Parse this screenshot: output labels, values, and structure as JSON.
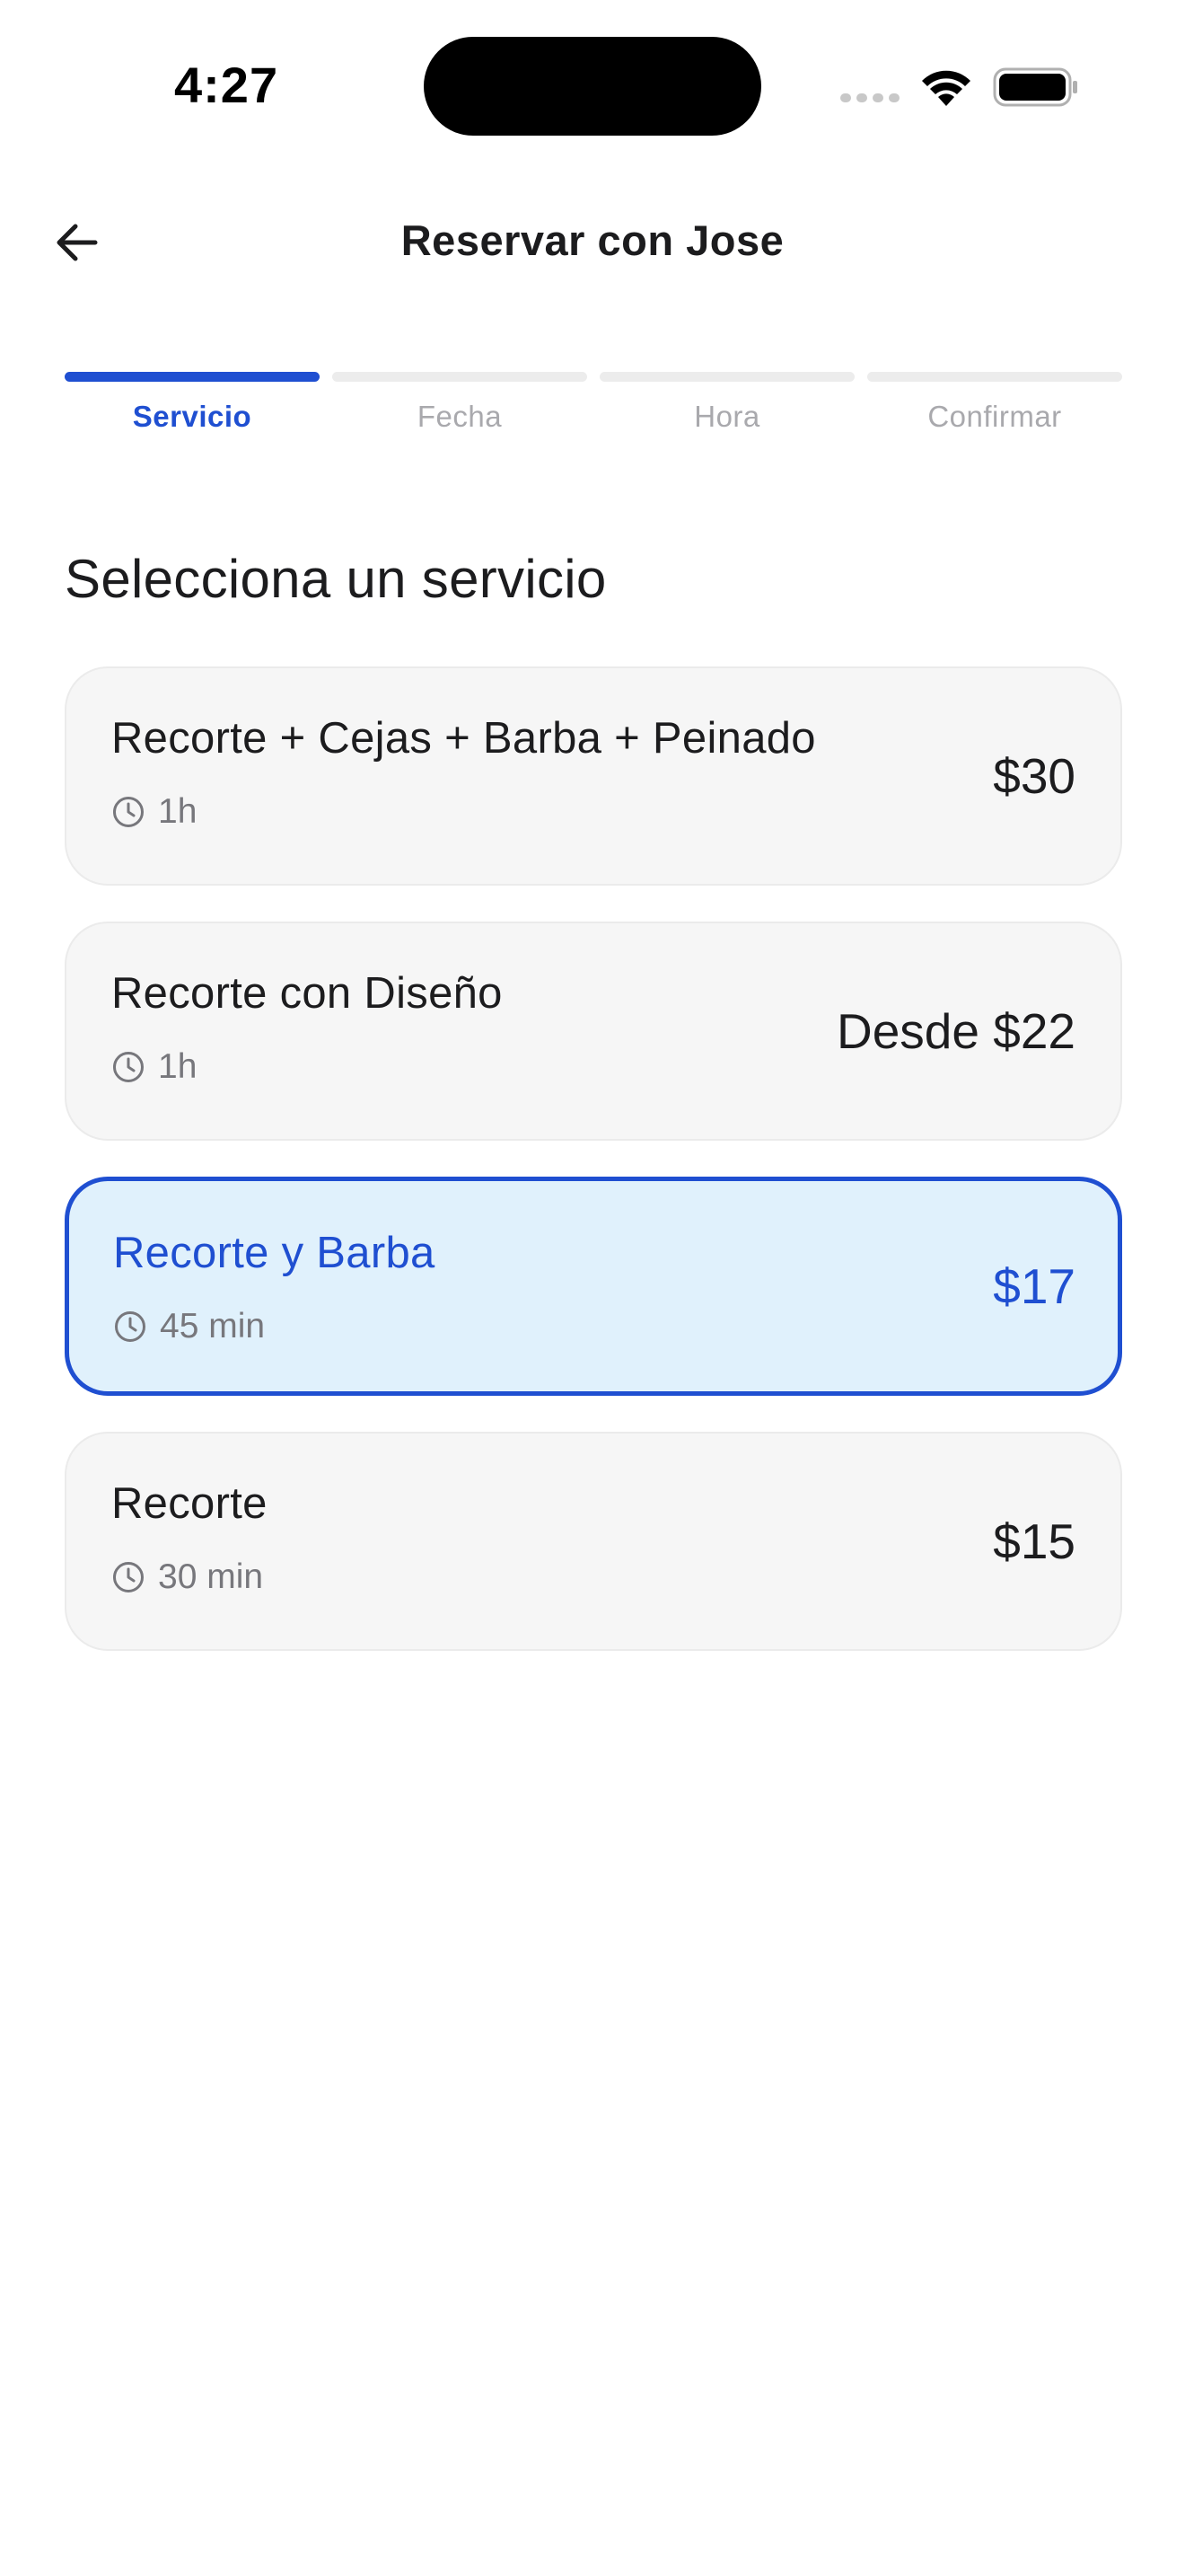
{
  "status_bar": {
    "time": "4:27"
  },
  "header": {
    "title": "Reservar con Jose",
    "back_icon": "arrow-left-icon"
  },
  "steps": [
    {
      "label": "Servicio",
      "active": true
    },
    {
      "label": "Fecha",
      "active": false
    },
    {
      "label": "Hora",
      "active": false
    },
    {
      "label": "Confirmar",
      "active": false
    }
  ],
  "section": {
    "title": "Selecciona un servicio"
  },
  "services": [
    {
      "name": "Recorte + Cejas + Barba + Peinado",
      "duration": "1h",
      "price": "$30",
      "selected": false
    },
    {
      "name": "Recorte con Diseño",
      "duration": "1h",
      "price": "Desde $22",
      "selected": false
    },
    {
      "name": "Recorte y Barba",
      "duration": "45 min",
      "price": "$17",
      "selected": true
    },
    {
      "name": "Recorte",
      "duration": "30 min",
      "price": "$15",
      "selected": false
    }
  ],
  "colors": {
    "accent": "#1f4fd1",
    "selected_background": "#e0f1fc",
    "card_background": "#f6f6f6",
    "muted_text": "#77777c"
  }
}
